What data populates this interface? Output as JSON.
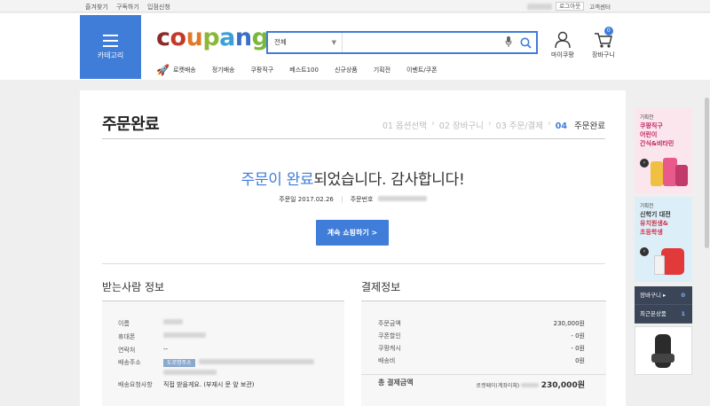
{
  "topbar": {
    "left": [
      "즐겨찾기",
      "구독하기",
      "입점신청"
    ],
    "logout": "로그아웃",
    "service": "고객센터"
  },
  "header": {
    "category": "카테고리",
    "logo": {
      "letters": [
        "c",
        "o",
        "u",
        "p",
        "a",
        "n",
        "g"
      ],
      "colors": [
        "#8b2a2a",
        "#c43a2a",
        "#e07a2a",
        "#8cb83a",
        "#3aa0d8",
        "#3a70c4",
        "#7ab83a"
      ]
    },
    "search": {
      "category": "전체",
      "placeholder": ""
    },
    "mypage": "마이쿠팡",
    "cart": "장바구니",
    "cart_count": "0",
    "nav": [
      "로켓배송",
      "정기배송",
      "쿠팡직구",
      "베스트100",
      "신규상품",
      "기획전",
      "이벤트/쿠폰"
    ]
  },
  "main": {
    "title": "주문완료",
    "steps": [
      {
        "label": "01 옵션선택"
      },
      {
        "label": "02 장바구니"
      },
      {
        "label": "03 주문/결제"
      },
      {
        "num": "04",
        "label": "주문완료"
      }
    ],
    "complete_hl": "주문이 완료",
    "complete_rest": "되었습니다. 감사합니다!",
    "order_date": "주문일 2017.02.26",
    "order_no_label": "주문번호",
    "continue_btn": "계속 쇼핑하기 >",
    "receiver": {
      "title": "받는사람 정보",
      "rows": [
        {
          "k": "이름",
          "v": ""
        },
        {
          "k": "휴대폰",
          "v": ""
        },
        {
          "k": "연락처",
          "v": "--"
        },
        {
          "k": "배송주소",
          "v": "",
          "tag": "도로명주소"
        },
        {
          "k": "배송요청사항",
          "v": "직접 받을게요. (부재시 문 앞 보관)"
        }
      ]
    },
    "payment": {
      "title": "결제정보",
      "rows": [
        {
          "k": "주문금액",
          "v": "230,000원"
        },
        {
          "k": "쿠폰할인",
          "v": "- 0원"
        },
        {
          "k": "쿠팡캐시",
          "v": "- 0원"
        },
        {
          "k": "배송비",
          "v": "0원"
        }
      ],
      "total_label": "총 결제금액",
      "total_method": "로켓페이(계좌이체)",
      "total_value": "230,000원"
    }
  },
  "side": {
    "ad1": {
      "tag": "기획전",
      "lines": [
        "쿠팡직구",
        "어린이",
        "간식&비타민"
      ]
    },
    "ad2": {
      "tag": "기획전",
      "lines": [
        "신학기 대전",
        "유치원생&",
        "초등학생"
      ]
    },
    "cart": "장바구니 ▸",
    "cart_count": "0",
    "recent": "최근본상품",
    "recent_count": "1"
  }
}
